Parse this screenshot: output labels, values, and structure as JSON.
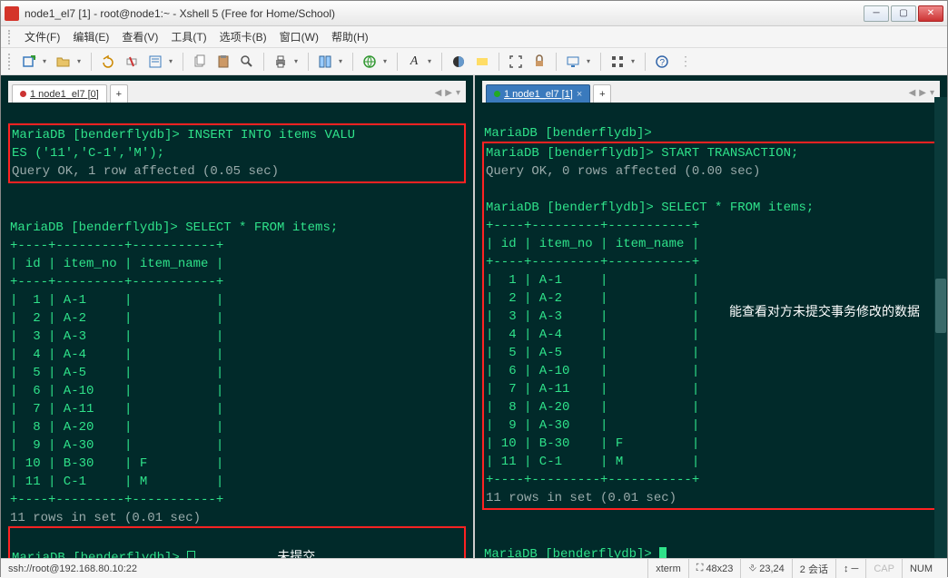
{
  "window": {
    "title": "node1_el7 [1] - root@node1:~ - Xshell 5 (Free for Home/School)"
  },
  "menu": {
    "file": "文件(F)",
    "edit": "编辑(E)",
    "view": "查看(V)",
    "tools": "工具(T)",
    "tabs": "选项卡(B)",
    "window": "窗口(W)",
    "help": "帮助(H)"
  },
  "maintabs": {
    "left": "1 node1_el7 [0]",
    "right": "1 node1_el7 [1]"
  },
  "left_term": {
    "line1": "MariaDB [benderflydb]> INSERT INTO items VALU",
    "line2": "ES ('11','C-1','M');",
    "line3": "Query OK, 1 row affected (0.05 sec)",
    "blank1": "",
    "select": "MariaDB [benderflydb]> SELECT * FROM items;",
    "hdr1": "+----+---------+-----------+",
    "hdr2": "| id | item_no | item_name |",
    "hdr3": "+----+---------+-----------+",
    "r1": "|  1 | A-1     |           |",
    "r2": "|  2 | A-2     |           |",
    "r3": "|  3 | A-3     |           |",
    "r4": "|  4 | A-4     |           |",
    "r5": "|  5 | A-5     |           |",
    "r6": "|  6 | A-10    |           |",
    "r7": "|  7 | A-11    |           |",
    "r8": "|  8 | A-20    |           |",
    "r9": "|  9 | A-30    |           |",
    "r10": "| 10 | B-30    | F         |",
    "r11": "| 11 | C-1     | M         |",
    "ftr": "+----+---------+-----------+",
    "count": "11 rows in set (0.01 sec)",
    "prompt": "MariaDB [benderflydb]> ",
    "annotation": "未提交"
  },
  "right_term": {
    "line0": "MariaDB [benderflydb]>",
    "line1": "MariaDB [benderflydb]> START TRANSACTION;",
    "line2": "Query OK, 0 rows affected (0.00 sec)",
    "blank1": "",
    "select": "MariaDB [benderflydb]> SELECT * FROM items;",
    "hdr1": "+----+---------+-----------+",
    "hdr2": "| id | item_no | item_name |",
    "hdr3": "+----+---------+-----------+",
    "r1": "|  1 | A-1     |           |",
    "r2": "|  2 | A-2     |           |",
    "r3": "|  3 | A-3     |           |",
    "r4": "|  4 | A-4     |           |",
    "r5": "|  5 | A-5     |           |",
    "r6": "|  6 | A-10    |           |",
    "r7": "|  7 | A-11    |           |",
    "r8": "|  8 | A-20    |           |",
    "r9": "|  9 | A-30    |           |",
    "r10": "| 10 | B-30    | F         |",
    "r11": "| 11 | C-1     | M         |",
    "ftr": "+----+---------+-----------+",
    "count": "11 rows in set (0.01 sec)",
    "prompt": "MariaDB [benderflydb]> ",
    "annotation": "能查看对方未提交事务修改的数据"
  },
  "status": {
    "conn": "ssh://root@192.168.80.10:22",
    "term": "xterm",
    "size": "48x23",
    "pos": "23,24",
    "sess": "2 会话",
    "cap": "CAP",
    "num": "NUM"
  }
}
